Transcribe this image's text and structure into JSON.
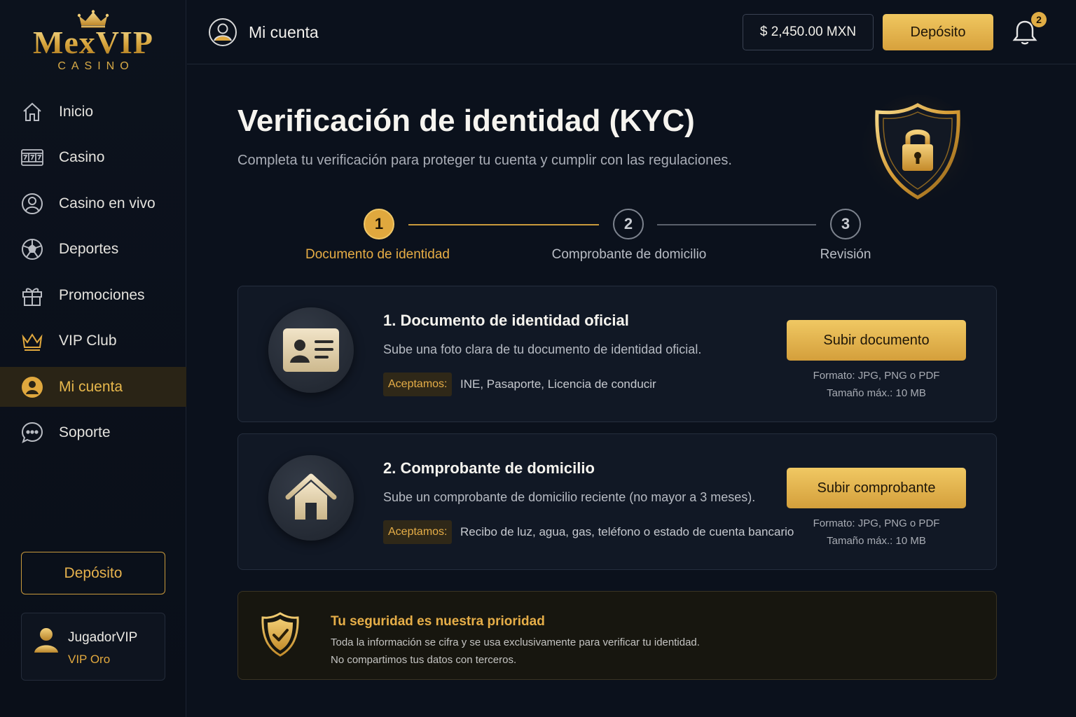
{
  "brand": {
    "logo_text": "MexVIP",
    "logo_sub": "CASINO",
    "accent": "#e0a83e"
  },
  "sidebar": {
    "items": [
      {
        "label": "Inicio",
        "icon": "home-icon"
      },
      {
        "label": "Casino",
        "icon": "slot-machine-icon"
      },
      {
        "label": "Casino en vivo",
        "icon": "live-dealer-icon"
      },
      {
        "label": "Deportes",
        "icon": "soccer-ball-icon"
      },
      {
        "label": "Promociones",
        "icon": "gift-icon"
      },
      {
        "label": "VIP Club",
        "icon": "crown-icon"
      },
      {
        "label": "Mi cuenta",
        "icon": "user-icon",
        "active": true
      },
      {
        "label": "Soporte",
        "icon": "chat-icon"
      }
    ],
    "deposit_label": "Depósito",
    "user": {
      "name": "JugadorVIP",
      "tier": "VIP Oro"
    }
  },
  "header": {
    "title": "Mi cuenta",
    "balance": "$ 2,450.00 MXN",
    "deposit_label": "Depósito",
    "notifications": "2"
  },
  "main": {
    "title": "Verificación de identidad (KYC)",
    "subtitle": "Completa tu verificación para proteger tu cuenta y cumplir con las regulaciones.",
    "steps": [
      {
        "number": "1",
        "label": "Documento de identidad",
        "state": "active"
      },
      {
        "number": "2",
        "label": "Comprobante de domicilio",
        "state": "pending"
      },
      {
        "number": "3",
        "label": "Revisión",
        "state": "pending"
      }
    ],
    "cards": [
      {
        "title": "1. Documento de identidad oficial",
        "description": "Sube una foto clara de tu documento de identidad oficial.",
        "accept_tag": "Aceptamos:",
        "accept_text": "INE, Pasaporte, Licencia de conducir",
        "button": "Subir documento",
        "format": "Formato: JPG, PNG o PDF",
        "size": "Tamaño máx.: 10 MB",
        "icon": "id-card-icon"
      },
      {
        "title": "2. Comprobante de domicilio",
        "description": "Sube un comprobante de domicilio reciente (no mayor a 3 meses).",
        "accept_tag": "Aceptamos:",
        "accept_text": "Recibo de luz, agua, gas, teléfono o estado de cuenta bancario",
        "button": "Subir comprobante",
        "format": "Formato: JPG, PNG o PDF",
        "size": "Tamaño máx.: 10 MB",
        "icon": "house-icon"
      }
    ],
    "security": {
      "title": "Tu seguridad es nuestra prioridad",
      "line1": "Toda la información se cifra y se usa exclusivamente para verificar tu identidad.",
      "line2": "No compartimos tus datos con terceros."
    }
  }
}
